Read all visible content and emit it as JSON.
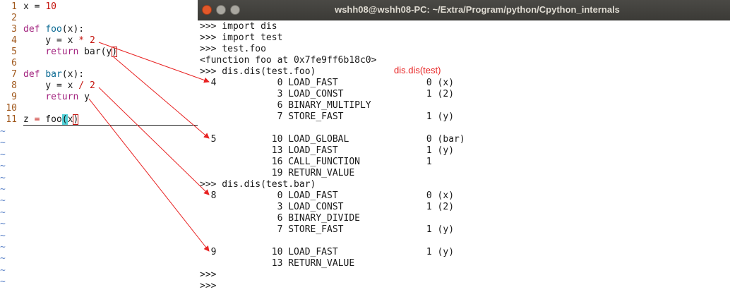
{
  "editor": {
    "lines": [
      {
        "n": "1",
        "segs": [
          [
            "x = ",
            ""
          ],
          [
            "10",
            "num"
          ]
        ]
      },
      {
        "n": "2",
        "segs": []
      },
      {
        "n": "3",
        "segs": [
          [
            "def",
            "kw"
          ],
          [
            " ",
            ""
          ],
          [
            "foo",
            "fn"
          ],
          [
            "(x):",
            ""
          ]
        ]
      },
      {
        "n": "4",
        "segs": [
          [
            "    y = x ",
            ""
          ],
          [
            "*",
            "op"
          ],
          [
            " ",
            ""
          ],
          [
            "2",
            "num"
          ]
        ]
      },
      {
        "n": "5",
        "segs": [
          [
            "    ",
            ""
          ],
          [
            "return",
            "kw"
          ],
          [
            " bar",
            ""
          ],
          [
            "(",
            ""
          ],
          [
            "y",
            ""
          ],
          [
            ")",
            "cur"
          ]
        ]
      },
      {
        "n": "6",
        "segs": []
      },
      {
        "n": "7",
        "segs": [
          [
            "def",
            "kw"
          ],
          [
            " ",
            ""
          ],
          [
            "bar",
            "fn"
          ],
          [
            "(x):",
            ""
          ]
        ]
      },
      {
        "n": "8",
        "segs": [
          [
            "    y = x ",
            ""
          ],
          [
            "/",
            "op"
          ],
          [
            " ",
            ""
          ],
          [
            "2",
            "num"
          ]
        ]
      },
      {
        "n": "9",
        "segs": [
          [
            "    ",
            ""
          ],
          [
            "return",
            "kw"
          ],
          [
            " y",
            ""
          ]
        ]
      },
      {
        "n": "10",
        "segs": []
      },
      {
        "n": "11",
        "segs": [
          [
            "z ",
            ""
          ],
          [
            "=",
            "op"
          ],
          [
            " foo",
            ""
          ],
          [
            "(",
            "hl"
          ],
          [
            "x",
            ""
          ],
          [
            ")",
            "cur"
          ]
        ]
      }
    ],
    "tilde": "~"
  },
  "terminal": {
    "title": "wshh08@wshh08-PC: ~/Extra/Program/python/Cpython_internals",
    "annotation": "dis.dis(test)",
    "lines": [
      ">>> import dis",
      ">>> import test",
      ">>> test.foo",
      "<function foo at 0x7fe9ff6b18c0>",
      ">>> dis.dis(test.foo)",
      "  4           0 LOAD_FAST                0 (x)",
      "              3 LOAD_CONST               1 (2)",
      "              6 BINARY_MULTIPLY",
      "              7 STORE_FAST               1 (y)",
      "",
      "  5          10 LOAD_GLOBAL              0 (bar)",
      "             13 LOAD_FAST                1 (y)",
      "             16 CALL_FUNCTION            1",
      "             19 RETURN_VALUE",
      ">>> dis.dis(test.bar)",
      "  8           0 LOAD_FAST                0 (x)",
      "              3 LOAD_CONST               1 (2)",
      "              6 BINARY_DIVIDE",
      "              7 STORE_FAST               1 (y)",
      "",
      "  9          10 LOAD_FAST                1 (y)",
      "             13 RETURN_VALUE",
      ">>>",
      ">>>"
    ]
  },
  "colors": {
    "arrow": "#e82222",
    "keyword": "#a2227e",
    "function_name": "#0a6a93",
    "number": "#c4140e",
    "line_number": "#a0581c",
    "tilde": "#5a82c8"
  }
}
